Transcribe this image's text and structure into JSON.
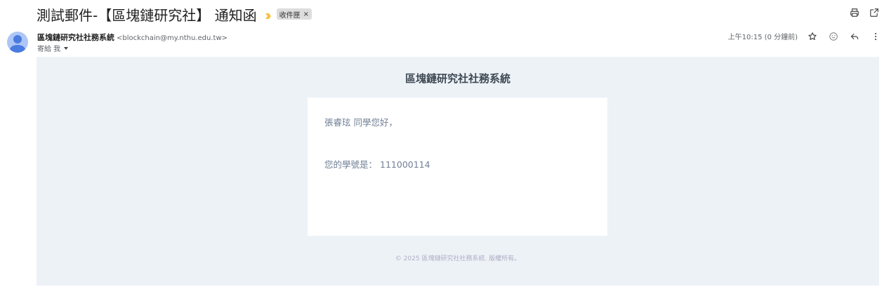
{
  "email": {
    "subject": "測試郵件-【區塊鏈研究社】 通知函",
    "label": "收件匣",
    "sender": {
      "name": "區塊鏈研究社社務系統",
      "email": "<blockchain@my.nthu.edu.tw>"
    },
    "recipient_text": "寄給 我",
    "timestamp": "上午10:15 (0 分鐘前)"
  },
  "icons": {
    "importance": "importance-marker-icon",
    "label_remove": "close-icon",
    "print": "print-icon",
    "open_new_window": "open-in-new-icon",
    "star": "star-icon",
    "emoji": "emoji-icon",
    "reply": "reply-icon",
    "more": "more-vert-icon"
  },
  "body": {
    "header": "區塊鏈研究社社務系統",
    "greeting": "張睿玹 同學您好，",
    "student_id_label": "您的學號是：",
    "student_id": "111000114",
    "footer": "© 2025 區塊鏈研究社社務系統. 版權所有。"
  },
  "colors": {
    "importance": "#f6c244",
    "body_bg": "#edf2f7",
    "card_bg": "#ffffff",
    "avatar_bg": "#aec6f5",
    "avatar_fg": "#4a7be0"
  }
}
